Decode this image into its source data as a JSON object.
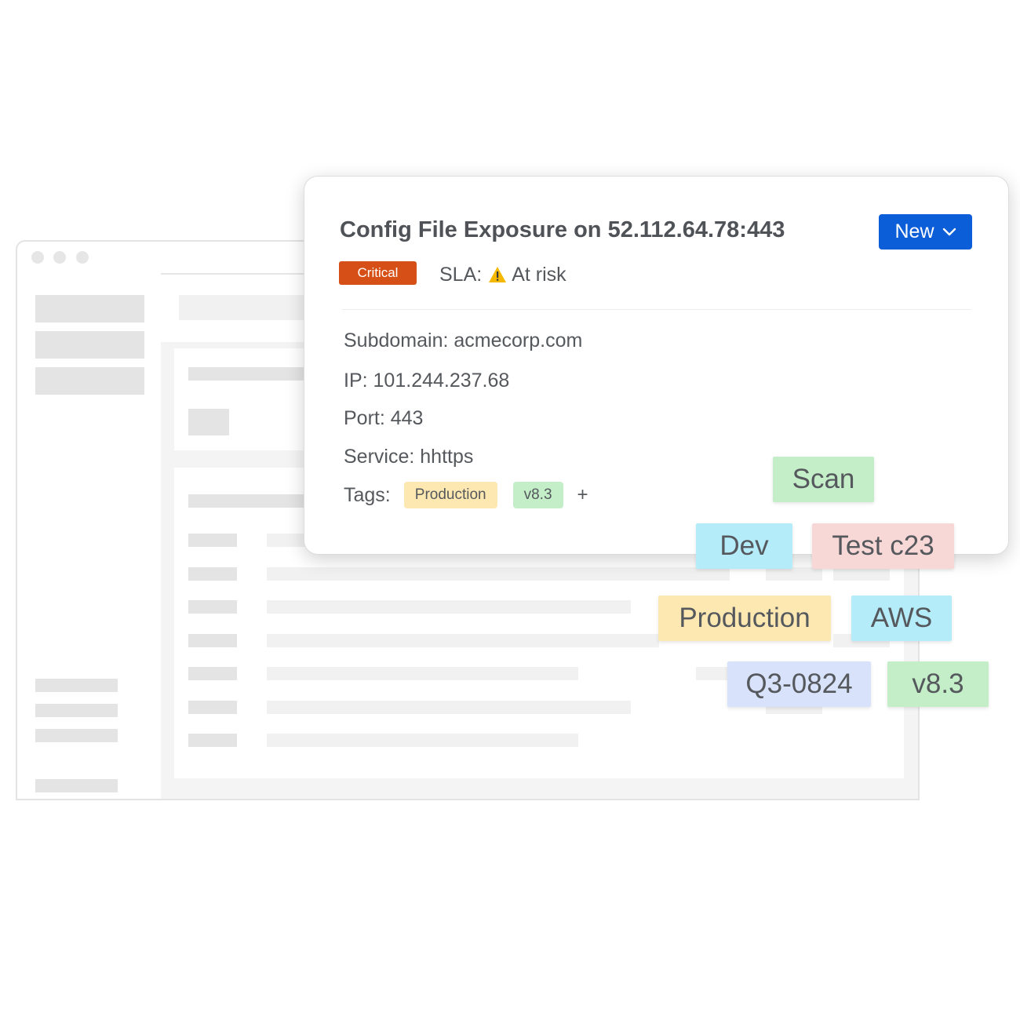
{
  "card": {
    "title": "Config File Exposure on 52.112.64.78:443",
    "status_button": "New",
    "severity": "Critical",
    "sla_label": "SLA:",
    "sla_value": "At risk",
    "fields": [
      {
        "label": "Subdomain:",
        "value": "acmecorp.com"
      },
      {
        "label": "IP:",
        "value": "101.244.237.68"
      },
      {
        "label": "Port:",
        "value": "443"
      },
      {
        "label": "Service:",
        "value": "hhttps"
      }
    ],
    "tags_label": "Tags:",
    "tags": [
      {
        "label": "Production",
        "color": "#fde8b2"
      },
      {
        "label": "v8.3",
        "color": "#c3eec8"
      }
    ],
    "add_tag": "+"
  },
  "floating_tags": [
    {
      "label": "Scan",
      "color": "#c3eec8"
    },
    {
      "label": "Dev",
      "color": "#b5ecf9"
    },
    {
      "label": "Test c23",
      "color": "#f8d7d7"
    },
    {
      "label": "Production",
      "color": "#fde8b2"
    },
    {
      "label": "AWS",
      "color": "#b5ecf9"
    },
    {
      "label": "Q3-0824",
      "color": "#d8e3fb"
    },
    {
      "label": "v8.3",
      "color": "#c3eec8"
    }
  ],
  "colors": {
    "primary": "#0b5ed7",
    "critical": "#d64f16",
    "warning": "#f5b800"
  }
}
